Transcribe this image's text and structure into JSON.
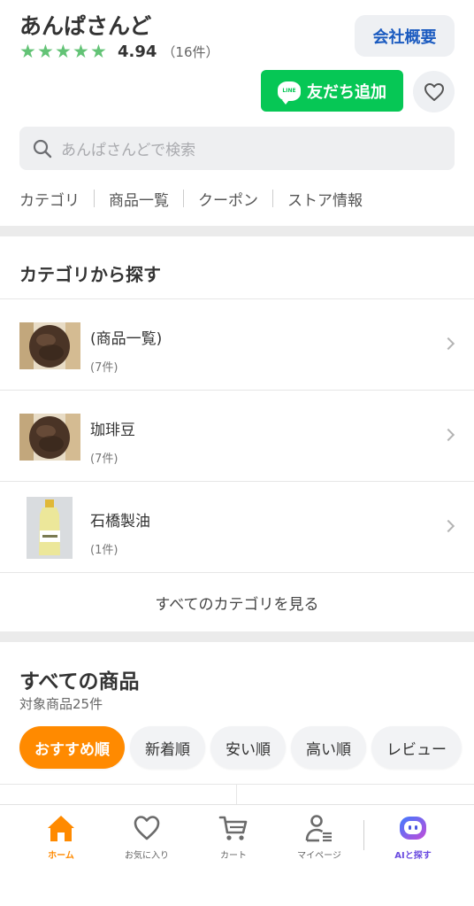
{
  "store": {
    "name": "あんぱさんど",
    "rating_score": "4.94",
    "rating_count": "（16件）",
    "stars": 5,
    "company_button": "会社概要",
    "line_button": "友だち追加",
    "line_logo_text": "LINE"
  },
  "search": {
    "placeholder": "あんぱさんどで検索"
  },
  "store_nav": [
    "カテゴリ",
    "商品一覧",
    "クーポン",
    "ストア情報"
  ],
  "categories": {
    "title": "カテゴリから探す",
    "items": [
      {
        "name": "(商品一覧)",
        "count": "(7件)"
      },
      {
        "name": "珈琲豆",
        "count": "(7件)"
      },
      {
        "name": "石橋製油",
        "count": "(1件)"
      }
    ],
    "see_all": "すべてのカテゴリを見る"
  },
  "products": {
    "title": "すべての商品",
    "count": "対象商品25件",
    "sort_options": [
      "おすすめ順",
      "新着順",
      "安い順",
      "高い順",
      "レビュー"
    ]
  },
  "bottom_nav": {
    "items": [
      "ホーム",
      "お気に入り",
      "カート",
      "マイページ"
    ],
    "ai_label": "AIと探す"
  },
  "colors": {
    "accent": "#ff8a00",
    "star": "#63c376",
    "line_green": "#06c755",
    "link_blue": "#1b5bc0"
  }
}
